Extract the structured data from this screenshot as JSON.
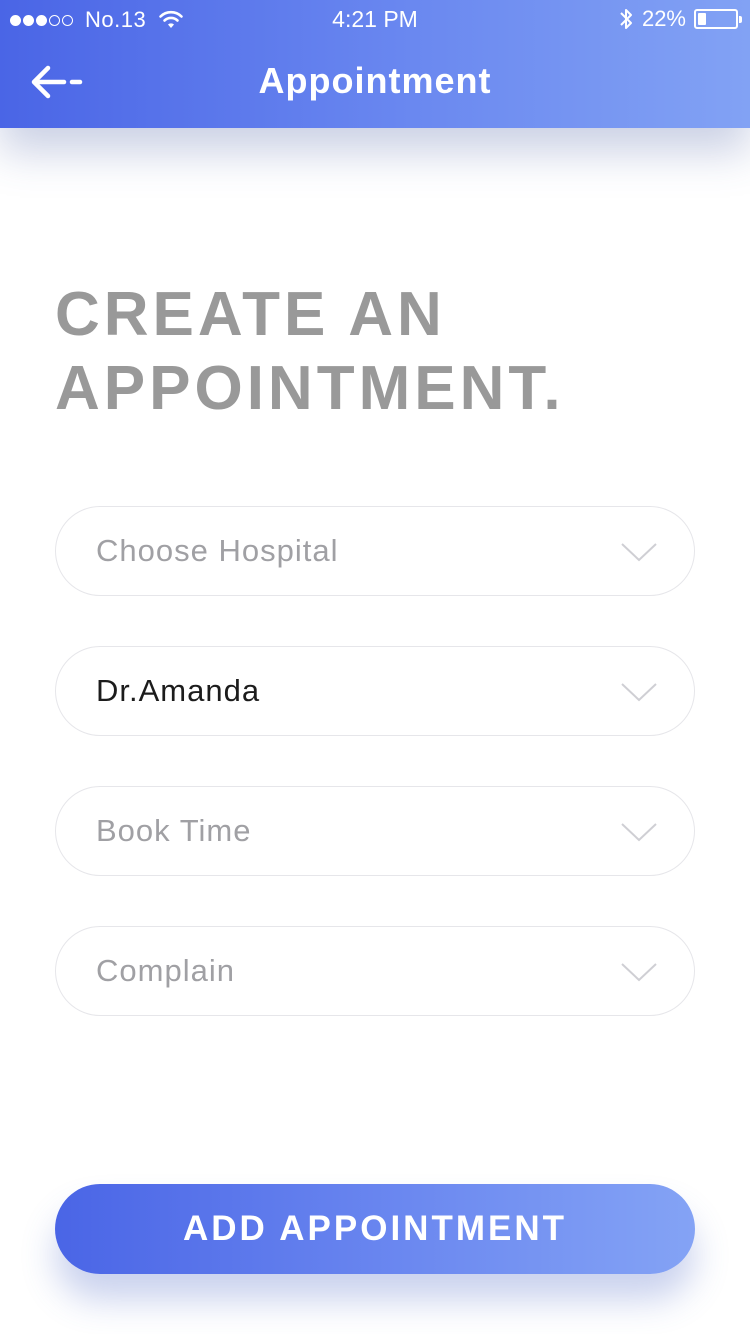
{
  "status_bar": {
    "carrier": "No.13",
    "time": "4:21 PM",
    "battery_percent": "22%",
    "battery_level": 0.22,
    "signal_filled": 3,
    "signal_total": 5,
    "icons": [
      "wifi-icon",
      "bluetooth-icon",
      "battery-icon"
    ]
  },
  "nav": {
    "title": "Appointment",
    "back_icon": "arrow-left-icon"
  },
  "heading": {
    "line1": "CREATE AN",
    "line2": "APPOINTMENT."
  },
  "form": {
    "hospital": {
      "placeholder": "Choose Hospital",
      "value": ""
    },
    "doctor": {
      "placeholder": "",
      "value": "Dr.Amanda"
    },
    "book_time": {
      "placeholder": "Book Time",
      "value": ""
    },
    "complain": {
      "placeholder": "Complain",
      "value": ""
    },
    "dropdown_icon": "chevron-down-icon"
  },
  "cta": {
    "label": "ADD APPOINTMENT"
  },
  "colors": {
    "gradient_start": "#4a65e6",
    "gradient_end": "#82a2f4",
    "heading": "#999999",
    "placeholder": "#a0a0a4",
    "value_text": "#1c1c1c",
    "field_border": "#e6e6ea"
  }
}
